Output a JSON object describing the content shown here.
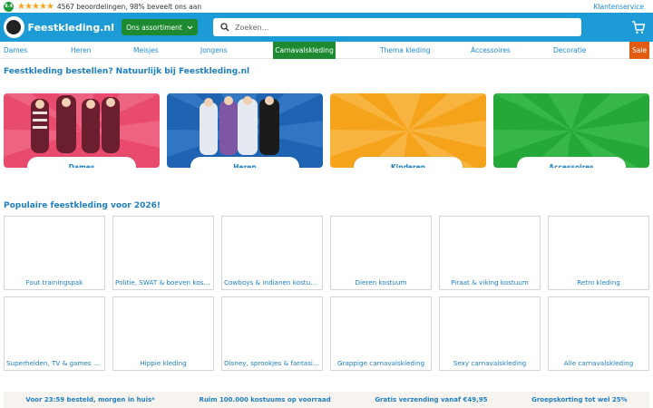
{
  "topbar": {
    "score": "9.4",
    "stars": "★★★★★",
    "reviews": "4567 beoordelingen, 98% beveelt ons aan",
    "service": "Klantenservice"
  },
  "header": {
    "logo_text": "Feestkleding.nl",
    "assortment_label": "Ons assortiment",
    "search_placeholder": "Zoeken...",
    "colors": {
      "bar": "#1d9bd7",
      "assortment": "#1d8a32"
    }
  },
  "nav": {
    "items": [
      {
        "label": "Dames"
      },
      {
        "label": "Heren"
      },
      {
        "label": "Meisjes"
      },
      {
        "label": "Jongens"
      },
      {
        "label": "Carnavalskleding",
        "active": true
      },
      {
        "label": "Thema kleding"
      },
      {
        "label": "Accessoires"
      },
      {
        "label": "Decoratie"
      },
      {
        "label": "Sale"
      }
    ],
    "colors": {
      "active": "#1d8a32",
      "sale": "#e35b10"
    }
  },
  "main": {
    "heading": "Feestkleding bestellen? Natuurlijk bij Feestkleding.nl",
    "categories": [
      {
        "label": "Dames",
        "color": "#e94b6e"
      },
      {
        "label": "Heren",
        "color": "#1f64b3"
      },
      {
        "label": "Kinderen",
        "color": "#f6a31c"
      },
      {
        "label": "Accessoires",
        "color": "#24a838"
      }
    ],
    "popular_heading": "Populaire feestkleding voor 2026!",
    "popular": [
      {
        "label": "Fout trainingspak"
      },
      {
        "label": "Politie, SWAT & boeven kostu..."
      },
      {
        "label": "Cowboys & indianen kostuum"
      },
      {
        "label": "Dieren kostuum"
      },
      {
        "label": "Piraat & viking kostuum"
      },
      {
        "label": "Retro kleding"
      },
      {
        "label": "Superhelden, TV & games ko..."
      },
      {
        "label": "Hippie kleding"
      },
      {
        "label": "Disney, sprookjes & fantasie k..."
      },
      {
        "label": "Grappige carnavalskleding"
      },
      {
        "label": "Sexy carnavalskleding"
      },
      {
        "label": "Alle carnavalskleding"
      }
    ]
  },
  "usp": [
    {
      "text": "Voor 23:59 besteld, morgen in huis*"
    },
    {
      "text": "Ruim 100.000 kostuums op voorraad"
    },
    {
      "text": "Gratis verzending vanaf €49,95"
    },
    {
      "text": "Groepskorting tot wel 25%"
    }
  ]
}
